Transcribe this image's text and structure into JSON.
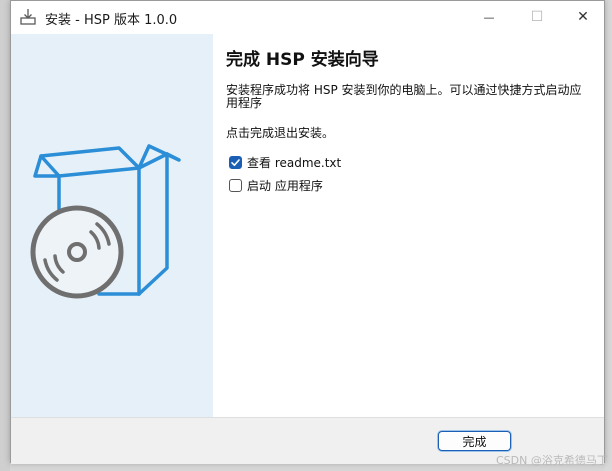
{
  "window": {
    "title": "安装 - HSP 版本 1.0.0",
    "minimize_glyph": "—",
    "maximize_glyph": "☐",
    "close_glyph": "✕"
  },
  "page": {
    "heading": "完成 HSP 安装向导",
    "description": "安装程序成功将 HSP 安装到你的电脑上。可以通过快捷方式启动应用程序",
    "exit_text": "点击完成退出安装。"
  },
  "options": [
    {
      "label": "查看 readme.txt",
      "checked": true
    },
    {
      "label": "启动 应用程序",
      "checked": false
    }
  ],
  "footer": {
    "finish_label": "完成"
  },
  "watermark": "CSDN @浴克希德马丁",
  "colors": {
    "accent": "#1a5fb4",
    "side_panel": "#e6f0f8",
    "box_art_blue": "#2b8ed6",
    "disc_gray": "#6f6f6f"
  },
  "icons": {
    "title": "installer-icon",
    "art": "box-with-disc-illustration"
  }
}
